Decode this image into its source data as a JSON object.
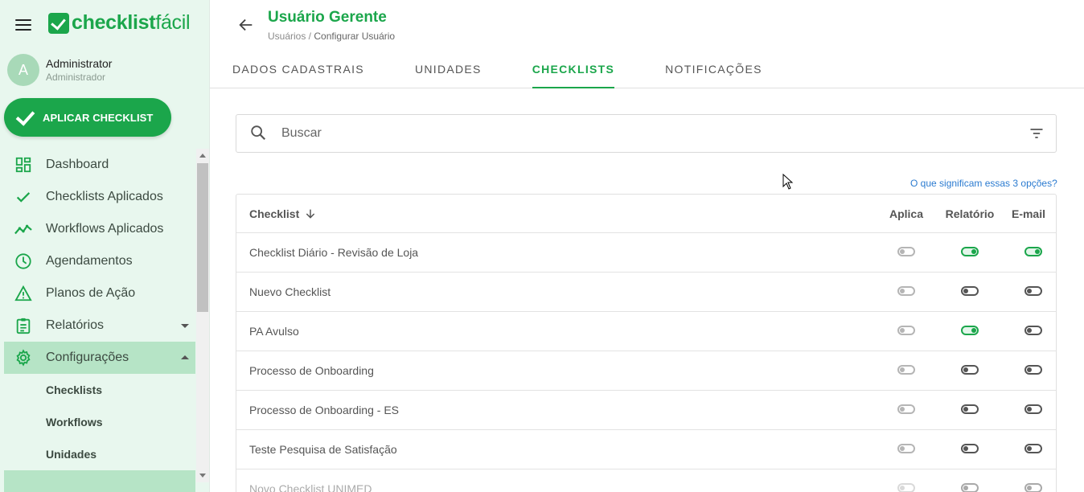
{
  "app": {
    "logo_bold": "checklist",
    "logo_thin": "fácil"
  },
  "user": {
    "initial": "A",
    "name": "Administrator",
    "role": "Administrador"
  },
  "apply_button": "APLICAR CHECKLIST",
  "nav": {
    "items": [
      {
        "label": "Dashboard",
        "icon": "dashboard-icon"
      },
      {
        "label": "Checklists Aplicados",
        "icon": "check-icon"
      },
      {
        "label": "Workflows Aplicados",
        "icon": "trend-icon"
      },
      {
        "label": "Agendamentos",
        "icon": "clock-icon"
      },
      {
        "label": "Planos de Ação",
        "icon": "warning-icon"
      },
      {
        "label": "Relatórios",
        "icon": "clipboard-icon"
      },
      {
        "label": "Configurações",
        "icon": "gear-icon"
      }
    ],
    "sub_items": [
      "Checklists",
      "Workflows",
      "Unidades"
    ]
  },
  "header": {
    "title": "Usuário Gerente",
    "breadcrumb_parent": "Usuários /",
    "breadcrumb_current": "Configurar Usuário"
  },
  "tabs": [
    "DADOS CADASTRAIS",
    "UNIDADES",
    "CHECKLISTS",
    "NOTIFICAÇÕES"
  ],
  "search": {
    "placeholder": "Buscar"
  },
  "help_link": "O que significam essas 3 opções?",
  "table": {
    "columns": {
      "checklist": "Checklist",
      "aplica": "Aplica",
      "relatorio": "Relatório",
      "email": "E-mail"
    },
    "rows": [
      {
        "name": "Checklist Diário - Revisão de Loja",
        "aplica": false,
        "relatorio": true,
        "email": true
      },
      {
        "name": "Nuevo Checklist",
        "aplica": false,
        "relatorio": false,
        "email": false
      },
      {
        "name": "PA Avulso",
        "aplica": false,
        "relatorio": true,
        "email": false
      },
      {
        "name": "Processo de Onboarding",
        "aplica": false,
        "relatorio": false,
        "email": false
      },
      {
        "name": "Processo de Onboarding - ES",
        "aplica": false,
        "relatorio": false,
        "email": false
      },
      {
        "name": "Teste Pesquisa de Satisfação",
        "aplica": false,
        "relatorio": false,
        "email": false
      },
      {
        "name": "Novo Checklist UNIMED",
        "aplica": false,
        "relatorio": false,
        "email": false
      }
    ]
  },
  "colors": {
    "brand": "#1ba64b",
    "sidebar_bg": "#e8f7ee",
    "active_nav": "#b6e4c6",
    "link": "#2b7bd0"
  }
}
